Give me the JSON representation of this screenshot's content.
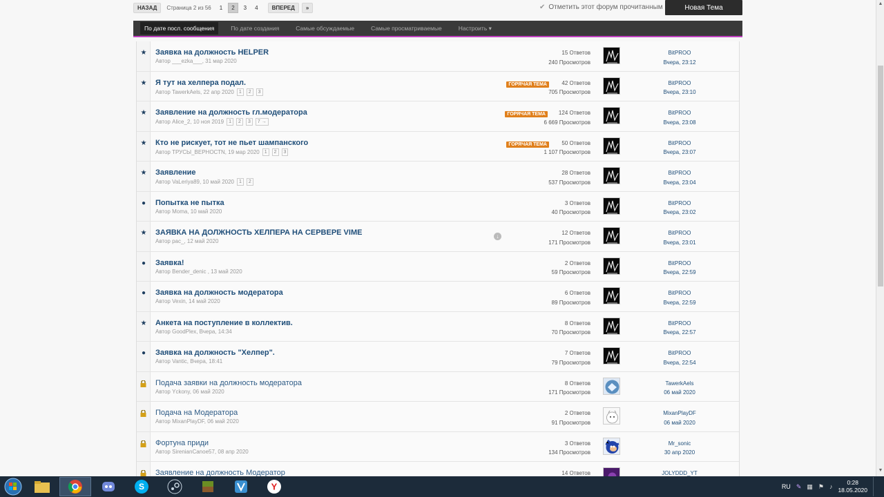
{
  "pager": {
    "back": "НАЗАД",
    "info": "Страница 2 из 56",
    "pages": [
      "1",
      "2",
      "3",
      "4"
    ],
    "active_page": "2",
    "next": "ВПЕРЕД",
    "last": "»"
  },
  "mark_read": "Отметить этот форум прочитанным",
  "new_topic": "Новая Тема",
  "tabs": [
    {
      "label": "По дате посл. сообщения",
      "active": true
    },
    {
      "label": "По дате создания",
      "active": false
    },
    {
      "label": "Самые обсуждаемые",
      "active": false
    },
    {
      "label": "Самые просматриваемые",
      "active": false
    },
    {
      "label": "Настроить",
      "active": false
    }
  ],
  "hot_label": "ГОРЯЧАЯ ТЕМА",
  "topics": [
    {
      "icon": "star",
      "title": "Заявка на должность HELPER",
      "meta": "Автор ___ezka___, 31 мар 2020",
      "pages": [],
      "hot": false,
      "replies": "15 Ответов",
      "views": "240 Просмотров",
      "last_user": "BitPROO",
      "last_time": "Вчера, 23:12",
      "avatar": "dark"
    },
    {
      "icon": "star",
      "title": "Я тут на хелпера подал.",
      "meta": "Автор TawerkAels, 22 апр 2020",
      "pages": [
        "1",
        "2",
        "3"
      ],
      "hot": true,
      "replies": "42 Ответов",
      "views": "705 Просмотров",
      "last_user": "BitPROO",
      "last_time": "Вчера, 23:10",
      "avatar": "dark"
    },
    {
      "icon": "star",
      "title": "Заявление на должность гл.модератора",
      "meta": "Автор Alice_2, 10 ноя 2019",
      "pages": [
        "1",
        "2",
        "3",
        "7 →"
      ],
      "hot": true,
      "replies": "124 Ответов",
      "views": "6 669 Просмотров",
      "last_user": "BitPROO",
      "last_time": "Вчера, 23:08",
      "avatar": "dark"
    },
    {
      "icon": "star",
      "title": "Кто не рискует, тот не пьет шампанского",
      "meta": "Автор ТРУСЫ_ВЕРНОСТN, 19 мар 2020",
      "pages": [
        "1",
        "2",
        "3"
      ],
      "hot": true,
      "replies": "50 Ответов",
      "views": "1 107 Просмотров",
      "last_user": "BitPROO",
      "last_time": "Вчера, 23:07",
      "avatar": "dark"
    },
    {
      "icon": "star",
      "title": "Заявление",
      "meta": "Автор VaLeriya89, 10 май 2020",
      "pages": [
        "1",
        "2"
      ],
      "hot": false,
      "replies": "28 Ответов",
      "views": "537 Просмотров",
      "last_user": "BitPROO",
      "last_time": "Вчера, 23:04",
      "avatar": "dark"
    },
    {
      "icon": "dot",
      "title": "Попытка не пытка",
      "meta": "Автор Moma, 10 май 2020",
      "pages": [],
      "hot": false,
      "replies": "3 Ответов",
      "views": "40 Просмотров",
      "last_user": "BitPROO",
      "last_time": "Вчера, 23:02",
      "avatar": "dark"
    },
    {
      "icon": "star",
      "title": "ЗАЯВКА НА ДОЛЖНОСТЬ ХЕЛПЕРА НА СЕРВЕРЕ VIME",
      "meta": "Автор pac_, 12 май 2020",
      "pages": [],
      "hot": false,
      "download": true,
      "replies": "12 Ответов",
      "views": "171 Просмотров",
      "last_user": "BitPROO",
      "last_time": "Вчера, 23:01",
      "avatar": "dark"
    },
    {
      "icon": "dot",
      "title": "Заявка!",
      "meta": "Автор Bender_denic , 13 май 2020",
      "pages": [],
      "hot": false,
      "replies": "2 Ответов",
      "views": "59 Просмотров",
      "last_user": "BitPROO",
      "last_time": "Вчера, 22:59",
      "avatar": "dark"
    },
    {
      "icon": "dot",
      "title": "Заявка на должность модератора",
      "meta": "Автор Vexin, 14 май 2020",
      "pages": [],
      "hot": false,
      "replies": "6 Ответов",
      "views": "89 Просмотров",
      "last_user": "BitPROO",
      "last_time": "Вчера, 22:59",
      "avatar": "dark"
    },
    {
      "icon": "star",
      "title": "Анкета на поступление в коллектив.",
      "meta": "Автор GoodPlex, Вчера, 14:34",
      "pages": [],
      "hot": false,
      "replies": "8 Ответов",
      "views": "70 Просмотров",
      "last_user": "BitPROO",
      "last_time": "Вчера, 22:57",
      "avatar": "dark"
    },
    {
      "icon": "dot",
      "title": "Заявка на должность \"Хелпер\".",
      "meta": "Автор Vantic, Вчера, 18:41",
      "pages": [],
      "hot": false,
      "replies": "7 Ответов",
      "views": "79 Просмотров",
      "last_user": "BitPROO",
      "last_time": "Вчера, 22:54",
      "avatar": "dark"
    },
    {
      "icon": "lock",
      "title": "Подача заявки на должность модератора",
      "meta": "Автор Yckony, 06 май 2020",
      "pages": [],
      "hot": false,
      "replies": "8 Ответов",
      "views": "171 Просмотров",
      "last_user": "TawerkAels",
      "last_time": "06 май 2020",
      "avatar": "blue"
    },
    {
      "icon": "lock",
      "title": "Подача на Модератора",
      "meta": "Автор MixanPlayDF, 06 май 2020",
      "pages": [],
      "hot": false,
      "replies": "2 Ответов",
      "views": "91 Просмотров",
      "last_user": "MixanPlayDF",
      "last_time": "06 май 2020",
      "avatar": "white"
    },
    {
      "icon": "lock",
      "title": "Фортуна приди",
      "meta": "Автор SirenianCanoe57, 08 апр 2020",
      "pages": [],
      "hot": false,
      "replies": "3 Ответов",
      "views": "134 Просмотров",
      "last_user": "Mr_sonic",
      "last_time": "30 апр 2020",
      "avatar": "sonic"
    },
    {
      "icon": "lock",
      "title": "Заявление на должность Модератор",
      "meta": "",
      "pages": [],
      "hot": false,
      "replies": "14 Ответов",
      "views": "",
      "last_user": "JOLYDDD_YT",
      "last_time": "",
      "avatar": "purple"
    }
  ],
  "taskbar": {
    "lang": "RU",
    "time": "0:28",
    "date": "18.05.2020",
    "apps": [
      "explorer-icon",
      "chrome-icon",
      "discord-icon",
      "skype-icon",
      "steam-icon",
      "minecraft-icon",
      "vimeworld-icon",
      "yandex-icon"
    ]
  }
}
